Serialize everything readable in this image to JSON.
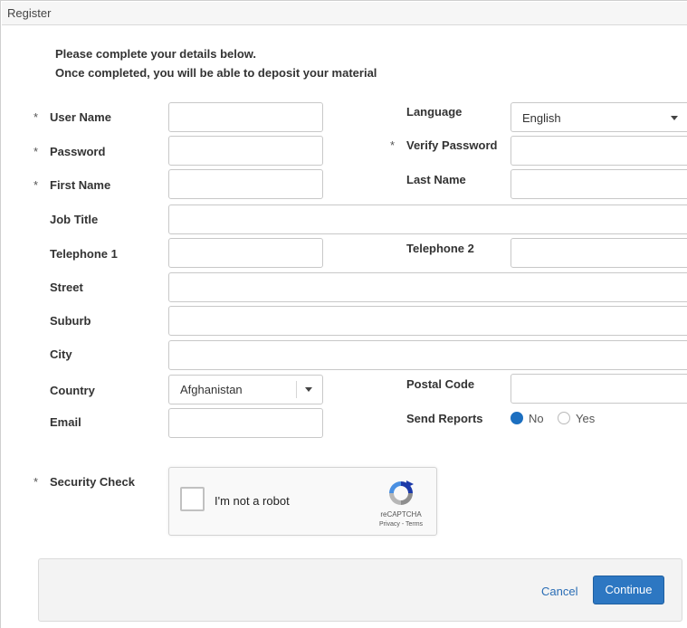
{
  "window": {
    "title": "Register"
  },
  "intro": {
    "line1": "Please complete your details below.",
    "line2": "Once completed, you will be able to deposit your material"
  },
  "required_marker": "*",
  "fields": {
    "user_name": {
      "label": "User Name",
      "required": true,
      "value": ""
    },
    "password": {
      "label": "Password",
      "required": true,
      "value": ""
    },
    "first_name": {
      "label": "First Name",
      "required": true,
      "value": ""
    },
    "job_title": {
      "label": "Job Title",
      "value": ""
    },
    "telephone1": {
      "label": "Telephone 1",
      "value": ""
    },
    "street": {
      "label": "Street",
      "value": ""
    },
    "suburb": {
      "label": "Suburb",
      "value": ""
    },
    "city": {
      "label": "City",
      "value": ""
    },
    "country": {
      "label": "Country",
      "value": "Afghanistan"
    },
    "email": {
      "label": "Email",
      "value": ""
    },
    "language": {
      "label": "Language",
      "value": "English"
    },
    "verify_password": {
      "label": "Verify Password",
      "required": true,
      "value": ""
    },
    "last_name": {
      "label": "Last Name",
      "value": ""
    },
    "telephone2": {
      "label": "Telephone 2",
      "value": ""
    },
    "postal_code": {
      "label": "Postal Code",
      "value": ""
    },
    "send_reports": {
      "label": "Send Reports",
      "options": [
        "No",
        "Yes"
      ],
      "selected": "No"
    }
  },
  "security": {
    "label": "Security Check",
    "required": true,
    "checkbox_text": "I'm not a robot",
    "brand": "reCAPTCHA",
    "links": "Privacy - Terms",
    "icon": "recaptcha-icon"
  },
  "actions": {
    "cancel": "Cancel",
    "continue": "Continue"
  },
  "colors": {
    "accent": "#2d77c2",
    "link": "#2a6db5",
    "radio_selected": "#1c6fc0"
  }
}
